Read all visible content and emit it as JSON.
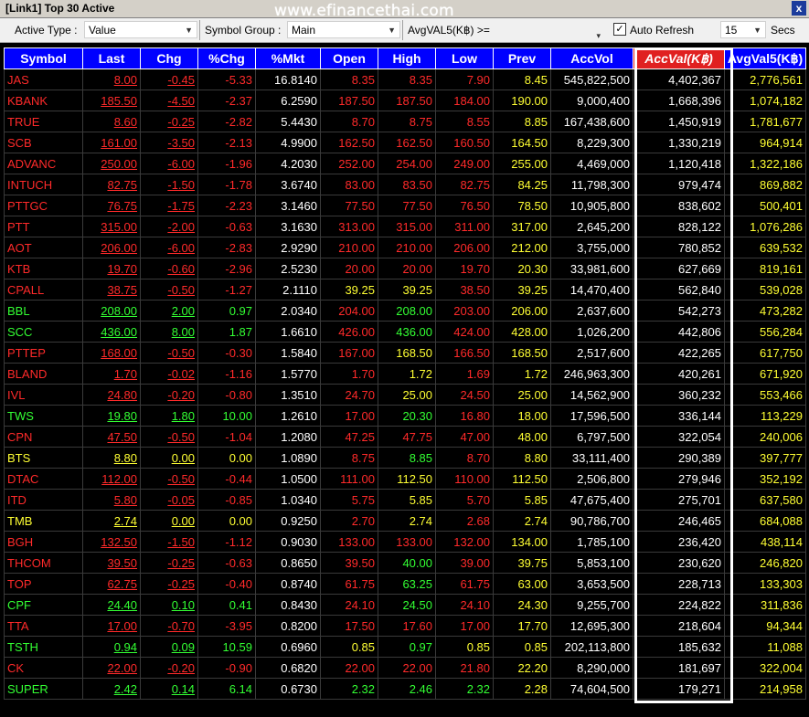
{
  "window": {
    "title": "[Link1] Top 30 Active",
    "watermark": "www.efinancethai.com",
    "close_label": "x"
  },
  "toolbar": {
    "active_type_label": "Active Type :",
    "active_type_value": "Value",
    "symbol_group_label": "Symbol Group :",
    "symbol_group_value": "Main",
    "avgval_label": "AvgVAL5(K฿) >=",
    "auto_refresh_label": "Auto Refresh",
    "auto_refresh_checked": true,
    "refresh_value": "15",
    "secs_label": "Secs"
  },
  "columns": [
    "Symbol",
    "Last",
    "Chg",
    "%Chg",
    "%Mkt",
    "Open",
    "High",
    "Low",
    "Prev",
    "AccVol",
    "AccVal(K฿)",
    "AvgVal5(K฿)"
  ],
  "sorted_column": "AccVal(K฿)",
  "colors": {
    "up": "#33ff33",
    "down": "#ff2a2a",
    "unchanged": "#ffff33",
    "header_bg": "#0000ff",
    "sorted_header_bg": "#e02020"
  },
  "rows": [
    {
      "symbol": "JAS",
      "last": "8.00",
      "chg": "-0.45",
      "pchg": "-5.33",
      "pmkt": "16.8140",
      "open": "8.35",
      "high": "8.35",
      "low": "7.90",
      "prev": "8.45",
      "accvol": "545,822,500",
      "accval": "4,402,367",
      "avgval5": "2,776,561",
      "open_c": "red",
      "high_c": "red",
      "low_c": "red",
      "trend": "down"
    },
    {
      "symbol": "KBANK",
      "last": "185.50",
      "chg": "-4.50",
      "pchg": "-2.37",
      "pmkt": "6.2590",
      "open": "187.50",
      "high": "187.50",
      "low": "184.00",
      "prev": "190.00",
      "accvol": "9,000,400",
      "accval": "1,668,396",
      "avgval5": "1,074,182",
      "open_c": "red",
      "high_c": "red",
      "low_c": "red",
      "trend": "down"
    },
    {
      "symbol": "TRUE",
      "last": "8.60",
      "chg": "-0.25",
      "pchg": "-2.82",
      "pmkt": "5.4430",
      "open": "8.70",
      "high": "8.75",
      "low": "8.55",
      "prev": "8.85",
      "accvol": "167,438,600",
      "accval": "1,450,919",
      "avgval5": "1,781,677",
      "open_c": "red",
      "high_c": "red",
      "low_c": "red",
      "trend": "down"
    },
    {
      "symbol": "SCB",
      "last": "161.00",
      "chg": "-3.50",
      "pchg": "-2.13",
      "pmkt": "4.9900",
      "open": "162.50",
      "high": "162.50",
      "low": "160.50",
      "prev": "164.50",
      "accvol": "8,229,300",
      "accval": "1,330,219",
      "avgval5": "964,914",
      "open_c": "red",
      "high_c": "red",
      "low_c": "red",
      "trend": "down"
    },
    {
      "symbol": "ADVANC",
      "last": "250.00",
      "chg": "-6.00",
      "pchg": "-1.96",
      "pmkt": "4.2030",
      "open": "252.00",
      "high": "254.00",
      "low": "249.00",
      "prev": "255.00",
      "accvol": "4,469,000",
      "accval": "1,120,418",
      "avgval5": "1,322,186",
      "open_c": "red",
      "high_c": "red",
      "low_c": "red",
      "trend": "down"
    },
    {
      "symbol": "INTUCH",
      "last": "82.75",
      "chg": "-1.50",
      "pchg": "-1.78",
      "pmkt": "3.6740",
      "open": "83.00",
      "high": "83.50",
      "low": "82.75",
      "prev": "84.25",
      "accvol": "11,798,300",
      "accval": "979,474",
      "avgval5": "869,882",
      "open_c": "red",
      "high_c": "red",
      "low_c": "red",
      "trend": "down"
    },
    {
      "symbol": "PTTGC",
      "last": "76.75",
      "chg": "-1.75",
      "pchg": "-2.23",
      "pmkt": "3.1460",
      "open": "77.50",
      "high": "77.50",
      "low": "76.50",
      "prev": "78.50",
      "accvol": "10,905,800",
      "accval": "838,602",
      "avgval5": "500,401",
      "open_c": "red",
      "high_c": "red",
      "low_c": "red",
      "trend": "down"
    },
    {
      "symbol": "PTT",
      "last": "315.00",
      "chg": "-2.00",
      "pchg": "-0.63",
      "pmkt": "3.1630",
      "open": "313.00",
      "high": "315.00",
      "low": "311.00",
      "prev": "317.00",
      "accvol": "2,645,200",
      "accval": "828,122",
      "avgval5": "1,076,286",
      "open_c": "red",
      "high_c": "red",
      "low_c": "red",
      "trend": "down"
    },
    {
      "symbol": "AOT",
      "last": "206.00",
      "chg": "-6.00",
      "pchg": "-2.83",
      "pmkt": "2.9290",
      "open": "210.00",
      "high": "210.00",
      "low": "206.00",
      "prev": "212.00",
      "accvol": "3,755,000",
      "accval": "780,852",
      "avgval5": "639,532",
      "open_c": "red",
      "high_c": "red",
      "low_c": "red",
      "trend": "down"
    },
    {
      "symbol": "KTB",
      "last": "19.70",
      "chg": "-0.60",
      "pchg": "-2.96",
      "pmkt": "2.5230",
      "open": "20.00",
      "high": "20.00",
      "low": "19.70",
      "prev": "20.30",
      "accvol": "33,981,600",
      "accval": "627,669",
      "avgval5": "819,161",
      "open_c": "red",
      "high_c": "red",
      "low_c": "red",
      "trend": "down"
    },
    {
      "symbol": "CPALL",
      "last": "38.75",
      "chg": "-0.50",
      "pchg": "-1.27",
      "pmkt": "2.1110",
      "open": "39.25",
      "high": "39.25",
      "low": "38.50",
      "prev": "39.25",
      "accvol": "14,470,400",
      "accval": "562,840",
      "avgval5": "539,028",
      "open_c": "yellow",
      "high_c": "yellow",
      "low_c": "red",
      "trend": "down"
    },
    {
      "symbol": "BBL",
      "last": "208.00",
      "chg": "2.00",
      "pchg": "0.97",
      "pmkt": "2.0340",
      "open": "204.00",
      "high": "208.00",
      "low": "203.00",
      "prev": "206.00",
      "accvol": "2,637,600",
      "accval": "542,273",
      "avgval5": "473,282",
      "open_c": "red",
      "high_c": "green",
      "low_c": "red",
      "trend": "up"
    },
    {
      "symbol": "SCC",
      "last": "436.00",
      "chg": "8.00",
      "pchg": "1.87",
      "pmkt": "1.6610",
      "open": "426.00",
      "high": "436.00",
      "low": "424.00",
      "prev": "428.00",
      "accvol": "1,026,200",
      "accval": "442,806",
      "avgval5": "556,284",
      "open_c": "red",
      "high_c": "green",
      "low_c": "red",
      "trend": "up"
    },
    {
      "symbol": "PTTEP",
      "last": "168.00",
      "chg": "-0.50",
      "pchg": "-0.30",
      "pmkt": "1.5840",
      "open": "167.00",
      "high": "168.50",
      "low": "166.50",
      "prev": "168.50",
      "accvol": "2,517,600",
      "accval": "422,265",
      "avgval5": "617,750",
      "open_c": "red",
      "high_c": "yellow",
      "low_c": "red",
      "trend": "down"
    },
    {
      "symbol": "BLAND",
      "last": "1.70",
      "chg": "-0.02",
      "pchg": "-1.16",
      "pmkt": "1.5770",
      "open": "1.70",
      "high": "1.72",
      "low": "1.69",
      "prev": "1.72",
      "accvol": "246,963,300",
      "accval": "420,261",
      "avgval5": "671,920",
      "open_c": "red",
      "high_c": "yellow",
      "low_c": "red",
      "trend": "down"
    },
    {
      "symbol": "IVL",
      "last": "24.80",
      "chg": "-0.20",
      "pchg": "-0.80",
      "pmkt": "1.3510",
      "open": "24.70",
      "high": "25.00",
      "low": "24.50",
      "prev": "25.00",
      "accvol": "14,562,900",
      "accval": "360,232",
      "avgval5": "553,466",
      "open_c": "red",
      "high_c": "yellow",
      "low_c": "red",
      "trend": "down"
    },
    {
      "symbol": "TWS",
      "last": "19.80",
      "chg": "1.80",
      "pchg": "10.00",
      "pmkt": "1.2610",
      "open": "17.00",
      "high": "20.30",
      "low": "16.80",
      "prev": "18.00",
      "accvol": "17,596,500",
      "accval": "336,144",
      "avgval5": "113,229",
      "open_c": "red",
      "high_c": "green",
      "low_c": "red",
      "trend": "up"
    },
    {
      "symbol": "CPN",
      "last": "47.50",
      "chg": "-0.50",
      "pchg": "-1.04",
      "pmkt": "1.2080",
      "open": "47.25",
      "high": "47.75",
      "low": "47.00",
      "prev": "48.00",
      "accvol": "6,797,500",
      "accval": "322,054",
      "avgval5": "240,006",
      "open_c": "red",
      "high_c": "red",
      "low_c": "red",
      "trend": "down"
    },
    {
      "symbol": "BTS",
      "last": "8.80",
      "chg": "0.00",
      "pchg": "0.00",
      "pmkt": "1.0890",
      "open": "8.75",
      "high": "8.85",
      "low": "8.70",
      "prev": "8.80",
      "accvol": "33,111,400",
      "accval": "290,389",
      "avgval5": "397,777",
      "open_c": "red",
      "high_c": "green",
      "low_c": "red",
      "trend": "flat"
    },
    {
      "symbol": "DTAC",
      "last": "112.00",
      "chg": "-0.50",
      "pchg": "-0.44",
      "pmkt": "1.0500",
      "open": "111.00",
      "high": "112.50",
      "low": "110.00",
      "prev": "112.50",
      "accvol": "2,506,800",
      "accval": "279,946",
      "avgval5": "352,192",
      "open_c": "red",
      "high_c": "yellow",
      "low_c": "red",
      "trend": "down"
    },
    {
      "symbol": "ITD",
      "last": "5.80",
      "chg": "-0.05",
      "pchg": "-0.85",
      "pmkt": "1.0340",
      "open": "5.75",
      "high": "5.85",
      "low": "5.70",
      "prev": "5.85",
      "accvol": "47,675,400",
      "accval": "275,701",
      "avgval5": "637,580",
      "open_c": "red",
      "high_c": "yellow",
      "low_c": "red",
      "trend": "down"
    },
    {
      "symbol": "TMB",
      "last": "2.74",
      "chg": "0.00",
      "pchg": "0.00",
      "pmkt": "0.9250",
      "open": "2.70",
      "high": "2.74",
      "low": "2.68",
      "prev": "2.74",
      "accvol": "90,786,700",
      "accval": "246,465",
      "avgval5": "684,088",
      "open_c": "red",
      "high_c": "yellow",
      "low_c": "red",
      "trend": "flat"
    },
    {
      "symbol": "BGH",
      "last": "132.50",
      "chg": "-1.50",
      "pchg": "-1.12",
      "pmkt": "0.9030",
      "open": "133.00",
      "high": "133.00",
      "low": "132.00",
      "prev": "134.00",
      "accvol": "1,785,100",
      "accval": "236,420",
      "avgval5": "438,114",
      "open_c": "red",
      "high_c": "red",
      "low_c": "red",
      "trend": "down"
    },
    {
      "symbol": "THCOM",
      "last": "39.50",
      "chg": "-0.25",
      "pchg": "-0.63",
      "pmkt": "0.8650",
      "open": "39.50",
      "high": "40.00",
      "low": "39.00",
      "prev": "39.75",
      "accvol": "5,853,100",
      "accval": "230,620",
      "avgval5": "246,820",
      "open_c": "red",
      "high_c": "green",
      "low_c": "red",
      "trend": "down"
    },
    {
      "symbol": "TOP",
      "last": "62.75",
      "chg": "-0.25",
      "pchg": "-0.40",
      "pmkt": "0.8740",
      "open": "61.75",
      "high": "63.25",
      "low": "61.75",
      "prev": "63.00",
      "accvol": "3,653,500",
      "accval": "228,713",
      "avgval5": "133,303",
      "open_c": "red",
      "high_c": "green",
      "low_c": "red",
      "trend": "down"
    },
    {
      "symbol": "CPF",
      "last": "24.40",
      "chg": "0.10",
      "pchg": "0.41",
      "pmkt": "0.8430",
      "open": "24.10",
      "high": "24.50",
      "low": "24.10",
      "prev": "24.30",
      "accvol": "9,255,700",
      "accval": "224,822",
      "avgval5": "311,836",
      "open_c": "red",
      "high_c": "green",
      "low_c": "red",
      "trend": "up"
    },
    {
      "symbol": "TTA",
      "last": "17.00",
      "chg": "-0.70",
      "pchg": "-3.95",
      "pmkt": "0.8200",
      "open": "17.50",
      "high": "17.60",
      "low": "17.00",
      "prev": "17.70",
      "accvol": "12,695,300",
      "accval": "218,604",
      "avgval5": "94,344",
      "open_c": "red",
      "high_c": "red",
      "low_c": "red",
      "trend": "down"
    },
    {
      "symbol": "TSTH",
      "last": "0.94",
      "chg": "0.09",
      "pchg": "10.59",
      "pmkt": "0.6960",
      "open": "0.85",
      "high": "0.97",
      "low": "0.85",
      "prev": "0.85",
      "accvol": "202,113,800",
      "accval": "185,632",
      "avgval5": "11,088",
      "open_c": "yellow",
      "high_c": "green",
      "low_c": "yellow",
      "trend": "up"
    },
    {
      "symbol": "CK",
      "last": "22.00",
      "chg": "-0.20",
      "pchg": "-0.90",
      "pmkt": "0.6820",
      "open": "22.00",
      "high": "22.00",
      "low": "21.80",
      "prev": "22.20",
      "accvol": "8,290,000",
      "accval": "181,697",
      "avgval5": "322,004",
      "open_c": "red",
      "high_c": "red",
      "low_c": "red",
      "trend": "down"
    },
    {
      "symbol": "SUPER",
      "last": "2.42",
      "chg": "0.14",
      "pchg": "6.14",
      "pmkt": "0.6730",
      "open": "2.32",
      "high": "2.46",
      "low": "2.32",
      "prev": "2.28",
      "accvol": "74,604,500",
      "accval": "179,271",
      "avgval5": "214,958",
      "open_c": "green",
      "high_c": "green",
      "low_c": "green",
      "trend": "up"
    }
  ]
}
